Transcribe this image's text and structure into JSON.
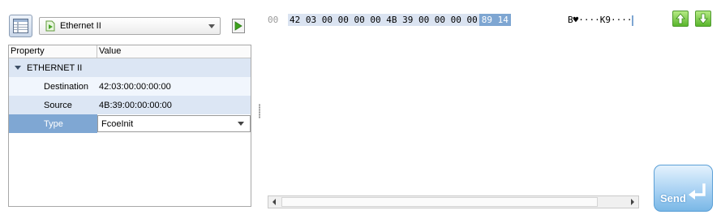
{
  "toolbar": {
    "view_icon": "table-view-icon",
    "protocol_icon": "packet-icon",
    "protocol_value": "Ethernet II",
    "add_icon": "play-icon"
  },
  "tree": {
    "headers": {
      "property": "Property",
      "value": "Value"
    },
    "group_label": "ETHERNET II",
    "rows": [
      {
        "property": "Destination",
        "value": "42:03:00:00:00:00"
      },
      {
        "property": "Source",
        "value": "4B:39:00:00:00:00"
      },
      {
        "property": "Type",
        "value": "FcoeInit"
      }
    ]
  },
  "hex": {
    "offset": "00",
    "bytes": "42 03 00 00 00 00 4B 39 00 00 00 00",
    "selected_bytes": "89 14",
    "ascii": "B♥····K9····"
  },
  "nav": {
    "up_icon": "arrow-up-icon",
    "down_icon": "arrow-down-icon"
  },
  "send": {
    "label": "Send",
    "icon": "enter-arrow-icon"
  },
  "colors": {
    "selection": "#7ea6d2",
    "row_highlight": "#dce6f4",
    "send_accent": "#5a9fd6",
    "nav_green": "#59b52c"
  }
}
